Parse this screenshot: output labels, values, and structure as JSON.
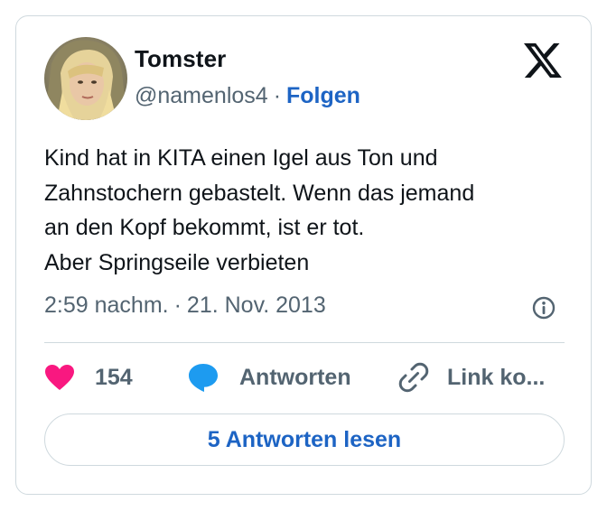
{
  "author": {
    "name": "Tomster",
    "handle": "@namenlos4",
    "separator": "·",
    "follow_label": "Folgen"
  },
  "tweet": {
    "lines": [
      "Kind hat in KITA einen Igel aus Ton und",
      "Zahnstochern gebastelt. Wenn das jemand",
      "an den Kopf bekommt, ist er tot.",
      "Aber Springseile verbieten"
    ],
    "time": "2:59 nachm.",
    "separator": "·",
    "date": "21. Nov. 2013"
  },
  "actions": {
    "like_count": "154",
    "reply_label": "Antworten",
    "copy_label": "Link ko..."
  },
  "read_replies_label": "5 Antworten lesen",
  "icons": {
    "logo": "x-logo-icon",
    "info": "info-icon",
    "like": "heart-icon",
    "reply": "speech-bubble-icon",
    "copy": "link-icon"
  },
  "colors": {
    "heart": "#f91880",
    "reply": "#1d9bf0",
    "link_blue": "#1d64c4",
    "muted": "#536471"
  }
}
